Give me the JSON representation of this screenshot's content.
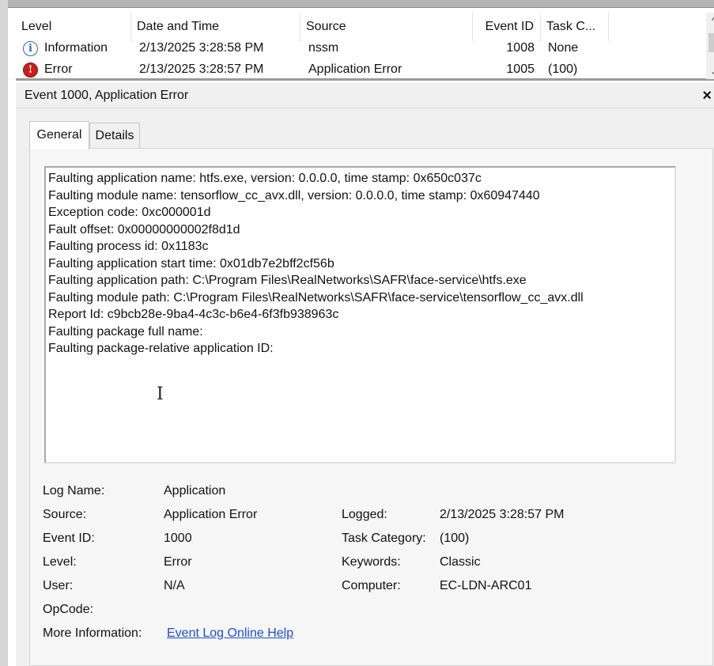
{
  "event_list": {
    "columns": [
      "Level",
      "Date and Time",
      "Source",
      "Event ID",
      "Task C..."
    ],
    "rows": [
      {
        "level": "Information",
        "level_icon": "info-icon",
        "date_time": "2/13/2025 3:28:58 PM",
        "source": "nssm",
        "event_id": "1008",
        "task_category": "None"
      },
      {
        "level": "Error",
        "level_icon": "error-icon",
        "date_time": "2/13/2025 3:28:57 PM",
        "source": "Application Error",
        "event_id": "1005",
        "task_category": "(100)"
      }
    ],
    "scroll_up": "^",
    "scroll_down": "⌄"
  },
  "detail": {
    "title": "Event 1000, Application Error",
    "close": "×",
    "tabs": [
      "General",
      "Details"
    ],
    "description_lines": [
      "Faulting application name: htfs.exe, version: 0.0.0.0, time stamp: 0x650c037c",
      "Faulting module name: tensorflow_cc_avx.dll, version: 0.0.0.0, time stamp: 0x60947440",
      "Exception code: 0xc000001d",
      "Fault offset: 0x00000000002f8d1d",
      "Faulting process id: 0x1183c",
      "Faulting application start time: 0x01db7e2bff2cf56b",
      "Faulting application path: C:\\Program Files\\RealNetworks\\SAFR\\face-service\\htfs.exe",
      "Faulting module path: C:\\Program Files\\RealNetworks\\SAFR\\face-service\\tensorflow_cc_avx.dll",
      "Report Id: c9bcb28e-9ba4-4c3c-b6e4-6f3fb938963c",
      "Faulting package full name:",
      "Faulting package-relative application ID:"
    ],
    "ibeam": "I",
    "props": {
      "log_name_label": "Log Name:",
      "log_name": "Application",
      "source_label": "Source:",
      "source": "Application Error",
      "logged_label": "Logged:",
      "logged": "2/13/2025 3:28:57 PM",
      "event_id_label": "Event ID:",
      "event_id": "1000",
      "task_category_label": "Task Category:",
      "task_category": "(100)",
      "level_label": "Level:",
      "level": "Error",
      "keywords_label": "Keywords:",
      "keywords": "Classic",
      "user_label": "User:",
      "user": "N/A",
      "computer_label": "Computer:",
      "computer": "EC-LDN-ARC01",
      "opcode_label": "OpCode:",
      "more_info_label": "More Information:",
      "more_info_link": "Event Log Online Help"
    }
  }
}
